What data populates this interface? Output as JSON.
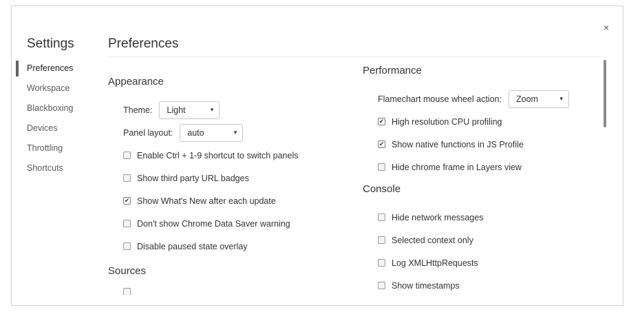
{
  "window": {
    "close_label": "×"
  },
  "sidebar": {
    "title": "Settings",
    "items": [
      {
        "label": "Preferences",
        "selected": true
      },
      {
        "label": "Workspace",
        "selected": false
      },
      {
        "label": "Blackboxing",
        "selected": false
      },
      {
        "label": "Devices",
        "selected": false
      },
      {
        "label": "Throttling",
        "selected": false
      },
      {
        "label": "Shortcuts",
        "selected": false
      }
    ]
  },
  "main": {
    "title": "Preferences",
    "appearance": {
      "title": "Appearance",
      "theme": {
        "label": "Theme:",
        "value": "Light"
      },
      "panel_layout": {
        "label": "Panel layout:",
        "value": "auto"
      },
      "checkboxes": [
        {
          "label": "Enable Ctrl + 1-9 shortcut to switch panels",
          "checked": false
        },
        {
          "label": "Show third party URL badges",
          "checked": false
        },
        {
          "label": "Show What's New after each update",
          "checked": true
        },
        {
          "label": "Don't show Chrome Data Saver warning",
          "checked": false
        },
        {
          "label": "Disable paused state overlay",
          "checked": false
        }
      ]
    },
    "sources": {
      "title": "Sources"
    },
    "performance": {
      "title": "Performance",
      "flamechart": {
        "label": "Flamechart mouse wheel action:",
        "value": "Zoom"
      },
      "checkboxes": [
        {
          "label": "High resolution CPU profiling",
          "checked": true
        },
        {
          "label": "Show native functions in JS Profile",
          "checked": true
        },
        {
          "label": "Hide chrome frame in Layers view",
          "checked": false
        }
      ]
    },
    "console": {
      "title": "Console",
      "checkboxes": [
        {
          "label": "Hide network messages",
          "checked": false
        },
        {
          "label": "Selected context only",
          "checked": false
        },
        {
          "label": "Log XMLHttpRequests",
          "checked": false
        },
        {
          "label": "Show timestamps",
          "checked": false
        }
      ]
    }
  },
  "icons": {
    "checkmark": "✔",
    "dropdown": "▾"
  }
}
